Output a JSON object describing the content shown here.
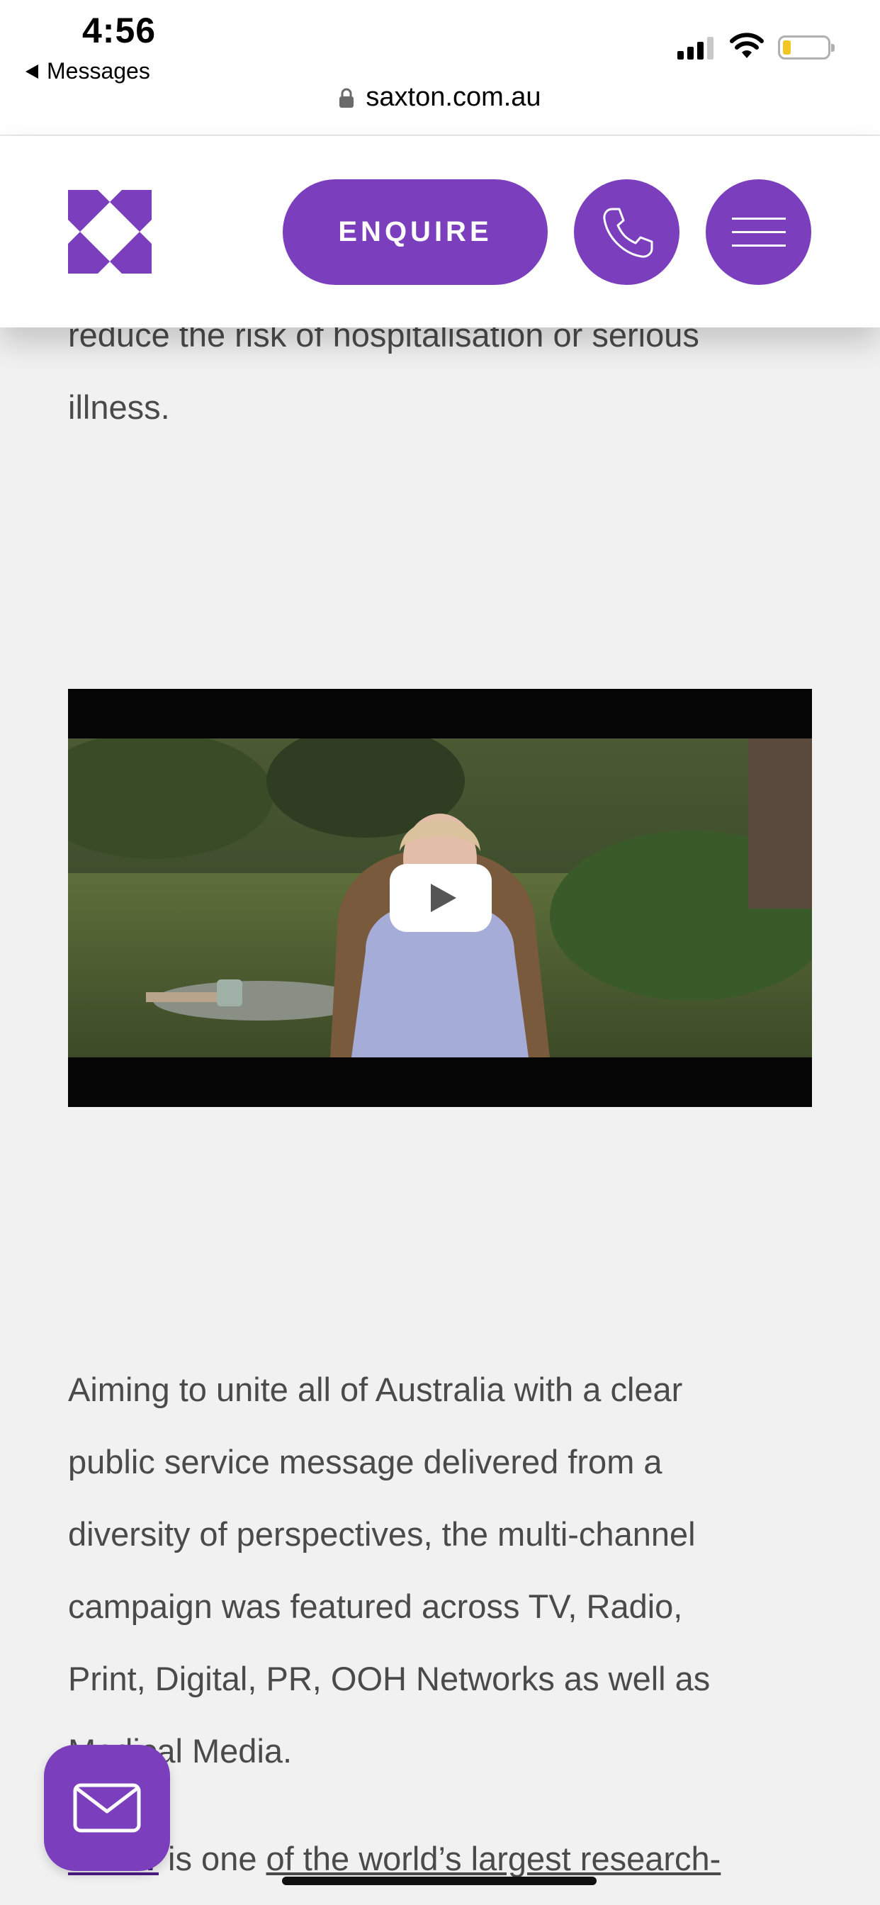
{
  "status_bar": {
    "time": "4:56",
    "back_label": "Messages",
    "url": "saxton.com.au",
    "battery_color": "#f3c623"
  },
  "header": {
    "logo_icon": "saxton-x-logo",
    "enquire_label": "ENQUIRE",
    "phone_icon": "phone-icon",
    "menu_icon": "hamburger-menu-icon",
    "brand_color": "#7b3fbe"
  },
  "content": {
    "intro_lines": [
      "reduce the risk of hospitalisation or serious",
      "illness."
    ],
    "body_lines": [
      "Aiming to unite all of Australia with a clear",
      "public service message delivered from a",
      "diversity of perspectives, the multi-channel",
      "campaign was featured across TV, Radio,",
      "Print, Digital, PR, OOH Networks as well as",
      "Medical Media."
    ],
    "pfizer_link": "Pfizer",
    "pfizer_sentence_a": " is one ",
    "pfizer_sentence_b": "of the world’s largest research-"
  },
  "video": {
    "play_icon": "play-icon"
  },
  "chat_button": {
    "icon": "mail-icon"
  }
}
